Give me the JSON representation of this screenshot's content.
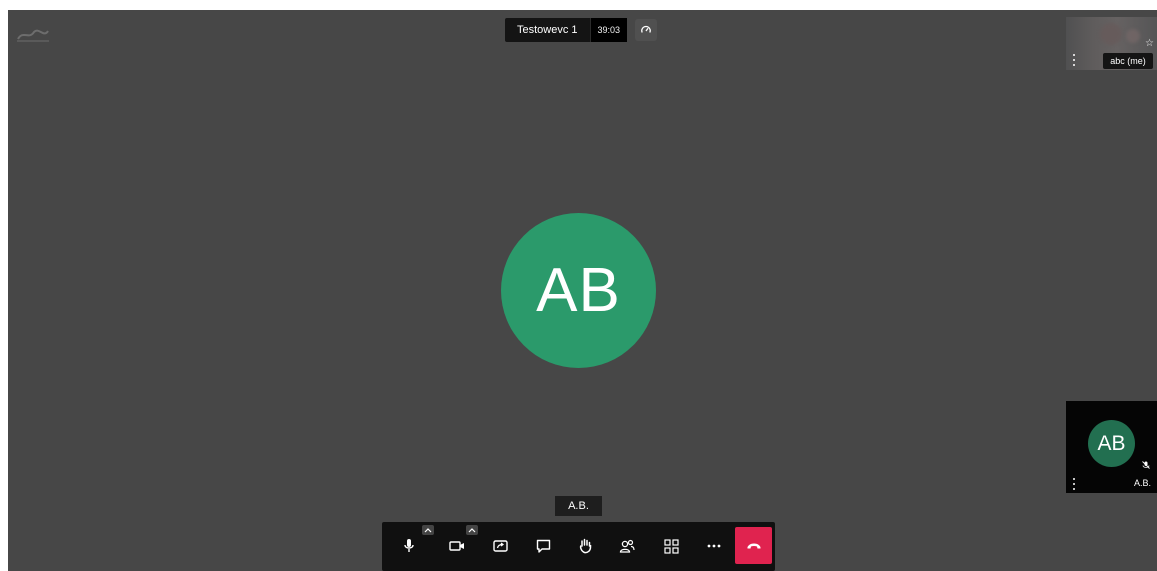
{
  "meeting": {
    "title": "Testowevc 1",
    "timer": "39:03"
  },
  "main_participant": {
    "initials": "AB",
    "speaker_label": "A.B."
  },
  "filmstrip": {
    "self": {
      "label": "abc (me)"
    },
    "remote": {
      "initials": "AB",
      "label": "A.B."
    }
  },
  "toolbar": {
    "buttons": [
      "microphone-icon",
      "camera-icon",
      "screen-share-icon",
      "chat-icon",
      "raise-hand-icon",
      "participants-icon",
      "tile-view-icon",
      "more-actions-icon",
      "hangup-icon"
    ]
  },
  "colors": {
    "stage": "#474747",
    "avatar_green": "#2b9a6b",
    "hangup_red": "#e0234f",
    "toolbar_bg": "#101010"
  }
}
